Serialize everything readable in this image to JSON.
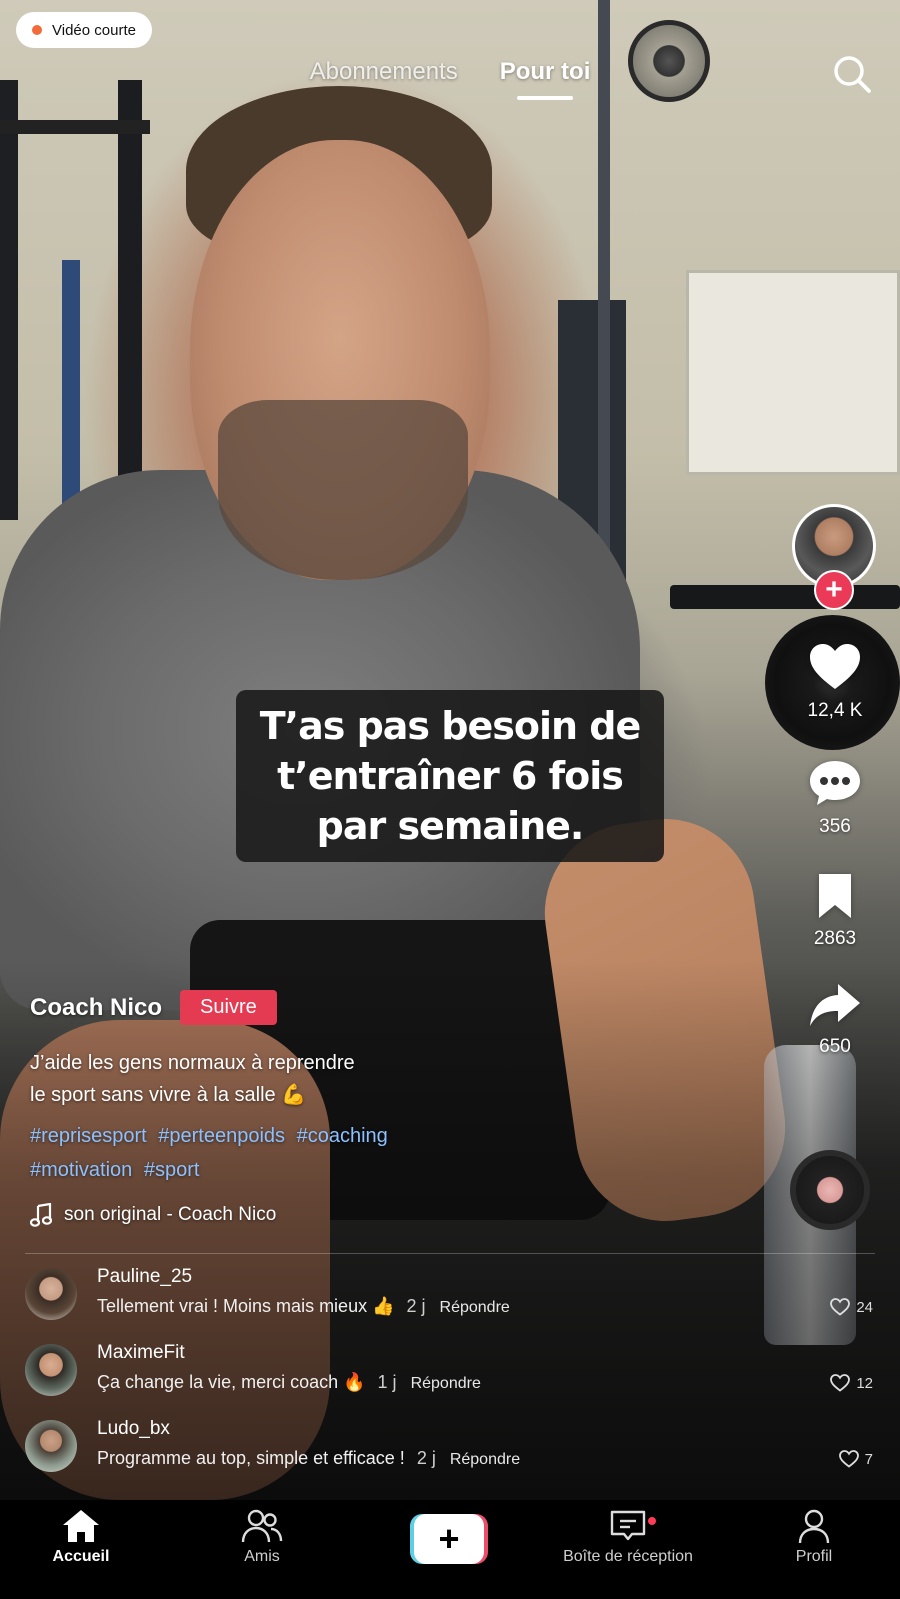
{
  "status_pill": {
    "label": "Vidéo courte",
    "dot_color": "#f26b3a"
  },
  "top_tabs": [
    {
      "label": "Abonnements",
      "active": false
    },
    {
      "label": "Pour toi",
      "active": true
    }
  ],
  "search_icon": "search-icon",
  "caption": "T’as pas besoin de t’entraîner 6 fois par semaine.",
  "actions": {
    "likes": "12,4 K",
    "comments": "356",
    "saves": "2863",
    "shares": "650"
  },
  "creator": {
    "name": "Coach Nico",
    "follow_label": "Suivre",
    "description_line1": "J’aide les gens normaux à reprendre",
    "description_line2": "le sport sans vivre à la salle 💪",
    "hashtags": [
      "#reprisesport",
      "#perteenpoids",
      "#coaching",
      "#motivation",
      "#sport"
    ],
    "sound": "son original - Coach Nico"
  },
  "comments": [
    {
      "user": "Pauline_25",
      "text": "Tellement vrai ! Moins mais mieux 👍",
      "time": "2 j",
      "reply": "Répondre",
      "likes": "24",
      "avatar_color": "#6e5848"
    },
    {
      "user": "MaximeFit",
      "text": "Ça change la vie, merci coach 🔥",
      "time": "1 j",
      "reply": "Répondre",
      "likes": "12",
      "avatar_color": "#5a6a5a"
    },
    {
      "user": "Ludo_bx",
      "text": "Programme au top, simple et efficace !",
      "time": "2 j",
      "reply": "Répondre",
      "likes": "7",
      "avatar_color": "#8a8f88"
    }
  ],
  "nav": {
    "home": "Accueil",
    "friends": "Amis",
    "inbox": "Boîte de réception",
    "profile": "Profil"
  },
  "colors": {
    "accent_red": "#e43b53",
    "hashtag_blue": "#8cc0ff",
    "create_cyan": "#5fcfe6",
    "create_pink": "#ec4d6a"
  }
}
